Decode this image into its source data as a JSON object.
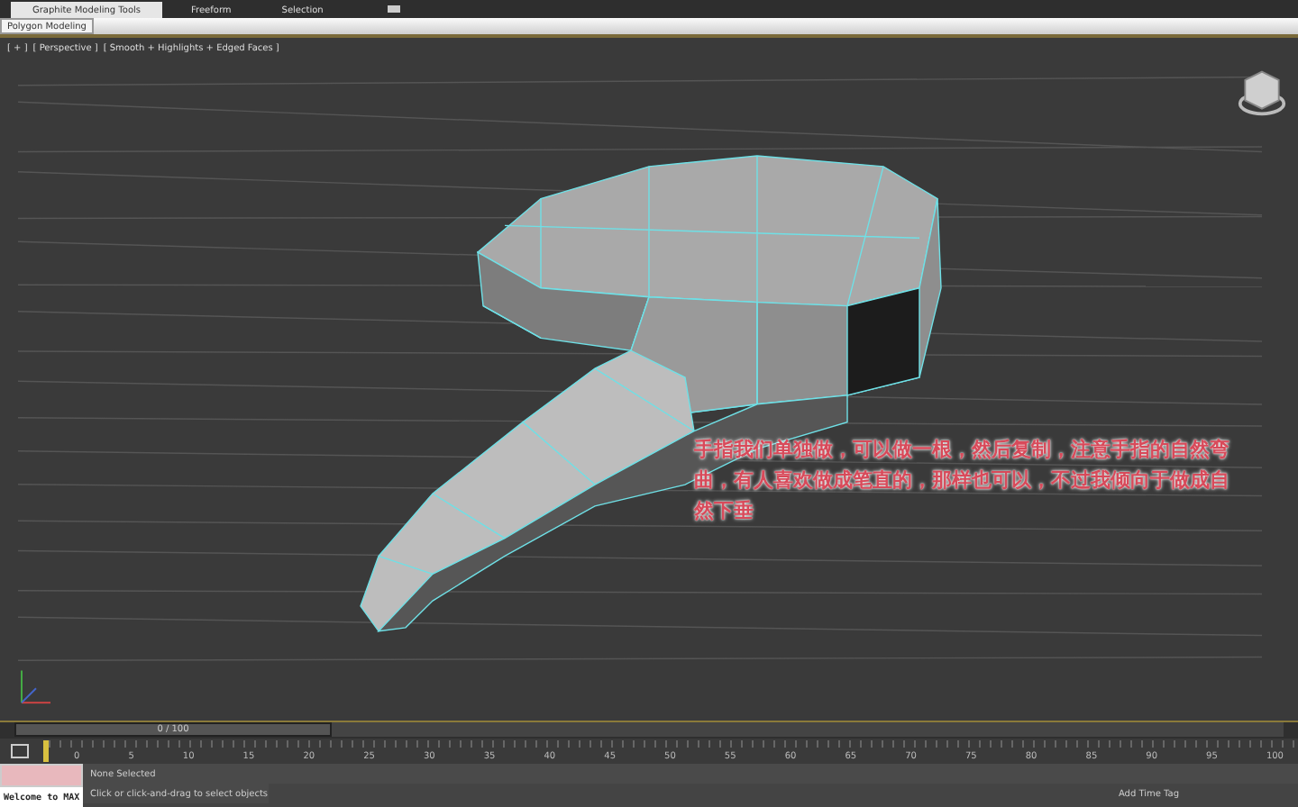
{
  "ribbon": {
    "tabs": [
      {
        "label": "Graphite Modeling Tools",
        "selected": true
      },
      {
        "label": "Freeform",
        "selected": false
      },
      {
        "label": "Selection",
        "selected": false
      }
    ],
    "panel_label": "Polygon Modeling"
  },
  "viewport": {
    "labels": [
      "[ + ]",
      "[ Perspective ]",
      "[ Smooth + Highlights + Edged Faces ]"
    ],
    "annotation": "手指我们单独做，可以做一根，然后复制，注意手指的自然弯曲，有人喜欢做成笔直的，那样也可以，不过我倾向于做成自然下垂"
  },
  "time_slider": {
    "position": "0 / 100",
    "level": 0
  },
  "timeline": {
    "ticks": [
      "0",
      "5",
      "10",
      "15",
      "20",
      "25",
      "30",
      "35",
      "40",
      "45",
      "50",
      "55",
      "60",
      "65",
      "70",
      "75",
      "80",
      "85",
      "90",
      "95",
      "100"
    ]
  },
  "status_bar": {
    "listener_text": "Welcome to MAX",
    "selection": "None Selected",
    "prompt": "Click or click-and-drag to select objects",
    "time_tag": "Add Time Tag"
  }
}
